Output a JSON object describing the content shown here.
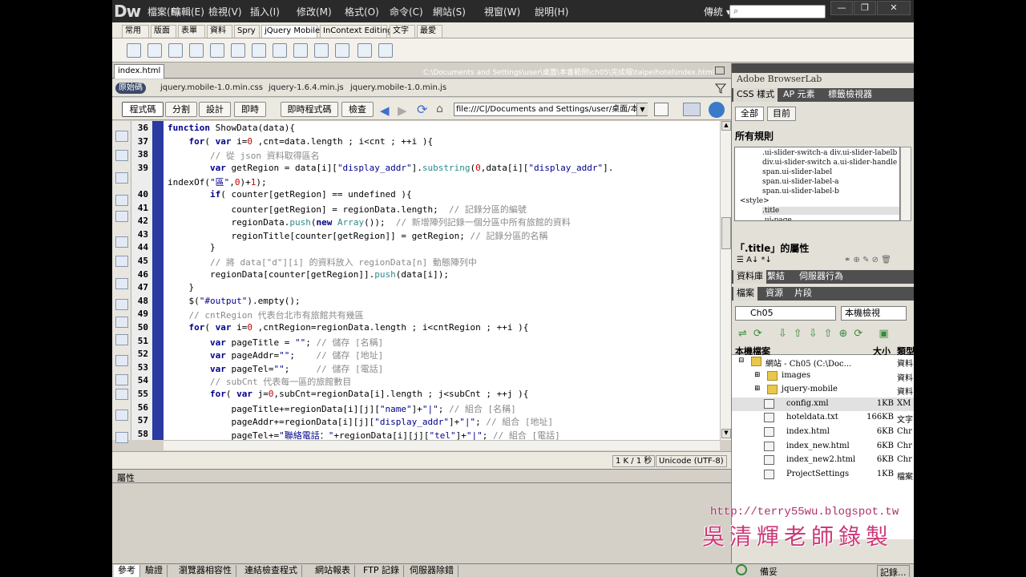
{
  "app": {
    "logo": "Dw",
    "workspace": "傳統 ▾",
    "window_controls": [
      "—",
      "❐",
      "✕"
    ]
  },
  "menu": [
    "檔案(F)",
    "編輯(E)",
    "檢視(V)",
    "插入(I)",
    "修改(M)",
    "格式(O)",
    "命令(C)",
    "網站(S)",
    "視窗(W)",
    "說明(H)"
  ],
  "insert_tabs": [
    "常用",
    "版面",
    "表單",
    "資料",
    "Spry",
    "jQuery Mobile",
    "InContext Editing",
    "文字",
    "最愛"
  ],
  "document": {
    "tab": "index.html",
    "path": "C:\\Documents and Settings\\user\\桌面\\本書範例\\ch05\\完成檔\\taipeihotel\\index.html",
    "source_code_btn": "原始碼",
    "related_files": [
      "jquery.mobile-1.0.min.css",
      "jquery-1.6.4.min.js",
      "jquery.mobile-1.0.min.js"
    ],
    "view_buttons": [
      "程式碼",
      "分割",
      "設計",
      "即時"
    ],
    "live_code": "即時程式碼",
    "inspect": "檢查",
    "address": "file:///C|/Documents and Settings/user/桌面/本書"
  },
  "code_lines": [
    {
      "n": "36",
      "html": "<span class='kw'>function</span> ShowData(data){"
    },
    {
      "n": "37",
      "html": "    <span class='kw'>for</span>( <span class='kw'>var</span> i=<span class='nu'>0</span> ,cnt=data.length ; i&lt;cnt ; ++i ){"
    },
    {
      "n": "38",
      "html": "        <span class='cm'>// 從 json 資料取得區名</span>"
    },
    {
      "n": "39",
      "html": "        <span class='kw'>var</span> getRegion = data[i][<span class='st'>\"display_addr\"</span>].<span class='fn'>substring</span>(<span class='nu'>0</span>,data[i][<span class='st'>\"display_addr\"</span>]."
    },
    {
      "n": "",
      "html": "indexOf(<span class='st'>\"區\"</span>,<span class='nu'>0</span>)+<span class='nu'>1</span>);"
    },
    {
      "n": "40",
      "html": "        <span class='kw'>if</span>( counter[getRegion] == undefined ){"
    },
    {
      "n": "41",
      "html": "            counter[getRegion] = regionData.length;  <span class='cm'>// 記錄分區的編號</span>"
    },
    {
      "n": "42",
      "html": "            regionData.<span class='fn'>push</span>(<span class='kw'>new</span> <span class='fn'>Array</span>());  <span class='cm'>// 新增陣列記錄一個分區中所有旅館的資料</span>"
    },
    {
      "n": "43",
      "html": "            regionTitle[counter[getRegion]] = getRegion; <span class='cm'>// 記錄分區的名稱</span>"
    },
    {
      "n": "44",
      "html": "        }"
    },
    {
      "n": "45",
      "html": "        <span class='cm'>// 將 data[\"d\"][i] 的資料放入 regionData[n] 動態陣列中</span>"
    },
    {
      "n": "46",
      "html": "        regionData[counter[getRegion]].<span class='fn'>push</span>(data[i]);"
    },
    {
      "n": "47",
      "html": "    }"
    },
    {
      "n": "48",
      "html": "    $(<span class='st'>\"#output\"</span>).empty();"
    },
    {
      "n": "49",
      "html": "    <span class='cm'>// cntRegion 代表台北市有旅館共有幾區</span>"
    },
    {
      "n": "50",
      "html": "    <span class='kw'>for</span>( <span class='kw'>var</span> i=<span class='nu'>0</span> ,cntRegion=regionData.length ; i&lt;cntRegion ; ++i ){"
    },
    {
      "n": "51",
      "html": "        <span class='kw'>var</span> pageTitle = <span class='st'>\"\"</span>; <span class='cm'>// 儲存 [名稱]</span>"
    },
    {
      "n": "52",
      "html": "        <span class='kw'>var</span> pageAddr=<span class='st'>\"\"</span>;    <span class='cm'>// 儲存 [地址]</span>"
    },
    {
      "n": "53",
      "html": "        <span class='kw'>var</span> pageTel=<span class='st'>\"\"</span>;     <span class='cm'>// 儲存 [電話]</span>"
    },
    {
      "n": "54",
      "html": "        <span class='cm'>// subCnt 代表每一區的旅館數目</span>"
    },
    {
      "n": "55",
      "html": "        <span class='kw'>for</span>( <span class='kw'>var</span> j=<span class='nu'>0</span>,subCnt=regionData[i].length ; j&lt;subCnt ; ++j ){"
    },
    {
      "n": "56",
      "html": "            pageTitle+=regionData[i][j][<span class='st'>\"name\"</span>]+<span class='st'>\"|\"</span>; <span class='cm'>// 組合 [名稱]</span>"
    },
    {
      "n": "57",
      "html": "            pageAddr+=regionData[i][j][<span class='st'>\"display_addr\"</span>]+<span class='st'>\"|\"</span>; <span class='cm'>// 組合 [地址]</span>"
    },
    {
      "n": "58",
      "html": "            pageTel+=<span class='st'>\"聯絡電話：\"</span>+regionData[i][j][<span class='st'>\"tel\"</span>]+<span class='st'>\"|\"</span>; <span class='cm'>// 組合 [電話]</span>"
    }
  ],
  "status": {
    "size": "1 K / 1 秒",
    "encoding": "Unicode (UTF-8)"
  },
  "properties_label": "屬性",
  "bottom_tabs": [
    "參考",
    "驗證",
    "瀏覽器相容性",
    "連結檢查程式",
    "網站報表",
    "FTP 記錄",
    "伺服器除錯"
  ],
  "right": {
    "browserlab": "Adobe BrowserLab",
    "css_tabs": [
      "CSS 樣式",
      "AP 元素",
      "標籤檢視器"
    ],
    "css_mode": [
      "全部",
      "目前"
    ],
    "all_rules_title": "所有規則",
    "rules": [
      ".ui-slider-switch-a div.ui-slider-labelb",
      "div.ui-slider-switch a.ui-slider-handle",
      "span.ui-slider-label",
      "span.ui-slider-label-a",
      "span.ui-slider-label-b",
      "<style>",
      ".title",
      ".ui-page"
    ],
    "props_title": "「.title」的屬性",
    "files_tabs": [
      "資料庫",
      "繫結",
      "伺服器行為"
    ],
    "files_subtabs": [
      "檔案",
      "資源",
      "片段"
    ],
    "site_select": "Ch05",
    "view_select": "本機檢視",
    "file_headers": [
      "本機檔案",
      "大小",
      "類型"
    ],
    "files": [
      {
        "name": "網站 - Ch05 (C:\\Doc...",
        "size": "",
        "type": "資料"
      },
      {
        "name": "images",
        "size": "",
        "type": "資料"
      },
      {
        "name": "jquery-mobile",
        "size": "",
        "type": "資料"
      },
      {
        "name": "config.xml",
        "size": "1KB",
        "type": "XM"
      },
      {
        "name": "hoteldata.txt",
        "size": "166KB",
        "type": "文字"
      },
      {
        "name": "index.html",
        "size": "6KB",
        "type": "Chr"
      },
      {
        "name": "index_new.html",
        "size": "6KB",
        "type": "Chr"
      },
      {
        "name": "index_new2.html",
        "size": "6KB",
        "type": "Chr"
      },
      {
        "name": "ProjectSettings",
        "size": "1KB",
        "type": "檔案"
      }
    ],
    "ready": "備妥",
    "log": "記錄..."
  },
  "watermark": {
    "url": "http://terry55wu.blogspot.tw",
    "text": "吳清輝老師錄製"
  }
}
